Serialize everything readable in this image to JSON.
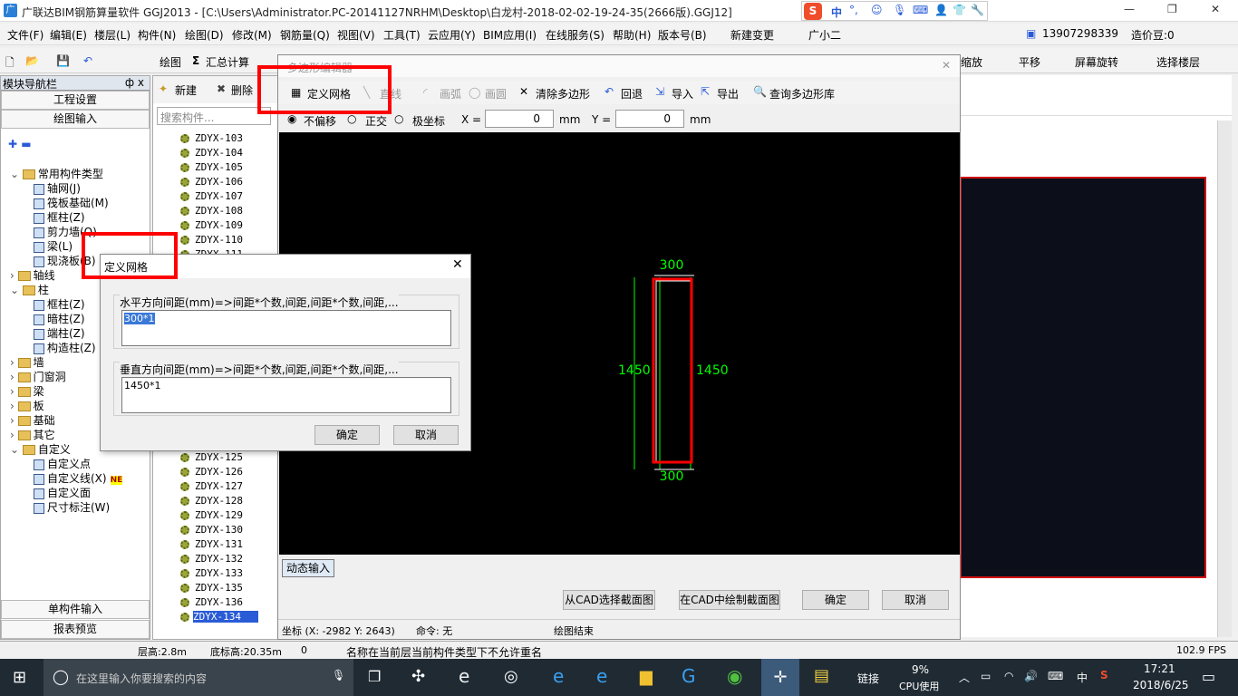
{
  "window": {
    "title": "广联达BIM钢筋算量软件 GGJ2013 - [C:\\Users\\Administrator.PC-20141127NRHM\\Desktop\\白龙村-2018-02-02-19-24-35(2666版).GGJ12]",
    "ime_label": "中",
    "controls": {
      "minimize": "—",
      "restore": "❐",
      "close": "✕"
    }
  },
  "menu": [
    "文件(F)",
    "编辑(E)",
    "楼层(L)",
    "构件(N)",
    "绘图(D)",
    "修改(M)",
    "钢筋量(Q)",
    "视图(V)",
    "工具(T)",
    "云应用(Y)",
    "BIM应用(I)",
    "在线服务(S)",
    "帮助(H)",
    "版本号(B)",
    "新建变更",
    "广小二"
  ],
  "account": {
    "phone": "13907298339",
    "coins": "造价豆:0"
  },
  "toolbar": {
    "draw": "绘图",
    "sum": "汇总计算",
    "zoom": "缩放",
    "pan": "平移",
    "rotate": "屏幕旋转",
    "select_floor": "选择楼层"
  },
  "nav": {
    "header": "模块导航栏",
    "pin": "ф x",
    "project_settings": "工程设置",
    "drawing_input": "绘图输入",
    "single_input": "单构件输入",
    "report_preview": "报表预览",
    "tree": [
      {
        "label": "常用构件类型",
        "level": 0,
        "kind": "folder-open"
      },
      {
        "label": "轴网(J)",
        "level": 1
      },
      {
        "label": "筏板基础(M)",
        "level": 1
      },
      {
        "label": "框柱(Z)",
        "level": 1
      },
      {
        "label": "剪力墙(Q)",
        "level": 1
      },
      {
        "label": "梁(L)",
        "level": 1
      },
      {
        "label": "现浇板(B)",
        "level": 1
      },
      {
        "label": "轴线",
        "level": 0,
        "kind": "folder"
      },
      {
        "label": "柱",
        "level": 0,
        "kind": "folder-open"
      },
      {
        "label": "框柱(Z)",
        "level": 1
      },
      {
        "label": "暗柱(Z)",
        "level": 1
      },
      {
        "label": "端柱(Z)",
        "level": 1
      },
      {
        "label": "构造柱(Z)",
        "level": 1
      },
      {
        "label": "墙",
        "level": 0,
        "kind": "folder"
      },
      {
        "label": "门窗洞",
        "level": 0,
        "kind": "folder"
      },
      {
        "label": "梁",
        "level": 0,
        "kind": "folder"
      },
      {
        "label": "板",
        "level": 0,
        "kind": "folder"
      },
      {
        "label": "基础",
        "level": 0,
        "kind": "folder"
      },
      {
        "label": "其它",
        "level": 0,
        "kind": "folder"
      },
      {
        "label": "自定义",
        "level": 0,
        "kind": "folder-open"
      },
      {
        "label": "自定义点",
        "level": 1
      },
      {
        "label": "自定义线(X)",
        "level": 1,
        "badge": "NE"
      },
      {
        "label": "自定义面",
        "level": 1
      },
      {
        "label": "尺寸标注(W)",
        "level": 1
      }
    ]
  },
  "components": {
    "new": "新建",
    "delete": "删除",
    "search_placeholder": "搜索构件...",
    "items_top": [
      "ZDYX-103",
      "ZDYX-104",
      "ZDYX-105",
      "ZDYX-106",
      "ZDYX-107",
      "ZDYX-108",
      "ZDYX-109",
      "ZDYX-110",
      "ZDYX-111"
    ],
    "items_bottom": [
      "ZDYX-125",
      "ZDYX-126",
      "ZDYX-127",
      "ZDYX-128",
      "ZDYX-129",
      "ZDYX-130",
      "ZDYX-131",
      "ZDYX-132",
      "ZDYX-133",
      "ZDYX-135",
      "ZDYX-136",
      "ZDYX-134"
    ],
    "selected": "ZDYX-134"
  },
  "poly_editor": {
    "title": "多边形编辑器",
    "tools": {
      "define_grid": "定义网格",
      "line": "直线",
      "arc": "画弧",
      "circle": "画圆",
      "clear": "清除多边形",
      "undo": "回退",
      "import": "导入",
      "export": "导出",
      "query": "查询多边形库"
    },
    "offset": {
      "none": "不偏移",
      "ortho": "正交",
      "polar": "极坐标",
      "x_label": "X =",
      "x_value": "0",
      "y_label": "Y =",
      "y_value": "0",
      "unit": "mm"
    },
    "dims": {
      "top": "300",
      "bottom": "300",
      "left": "1450",
      "right": "1450"
    },
    "dynamic_input": "动态输入",
    "btn_cad_select": "从CAD选择截面图",
    "btn_cad_draw": "在CAD中绘制截面图",
    "btn_ok": "确定",
    "btn_cancel": "取消",
    "coords": "坐标 (X: -2982 Y: 2643)",
    "command": "命令: 无",
    "draw_end": "绘图结束"
  },
  "grid_dialog": {
    "title": "定义网格",
    "h_label": "水平方向间距(mm)=>间距*个数,间距,间距*个数,间距,...",
    "h_value": "300*1",
    "v_label": "垂直方向间距(mm)=>间距*个数,间距,间距*个数,间距,...",
    "v_value": "1450*1",
    "ok": "确定",
    "cancel": "取消"
  },
  "status": {
    "floor_height": "层高:2.8m",
    "bottom_height": "底标高:20.35m",
    "count": "0",
    "message": "名称在当前层当前构件类型下不允许重名",
    "fps": "102.9 FPS"
  },
  "taskbar": {
    "search_placeholder": "在这里输入你要搜索的内容",
    "link": "链接",
    "cpu_pct": "9%",
    "cpu_label": "CPU使用",
    "ime": "中",
    "time": "17:21",
    "date": "2018/6/25"
  },
  "colors": {
    "accent_red": "#ff0000",
    "dim_green": "#00ff00",
    "canvas": "#000000"
  }
}
